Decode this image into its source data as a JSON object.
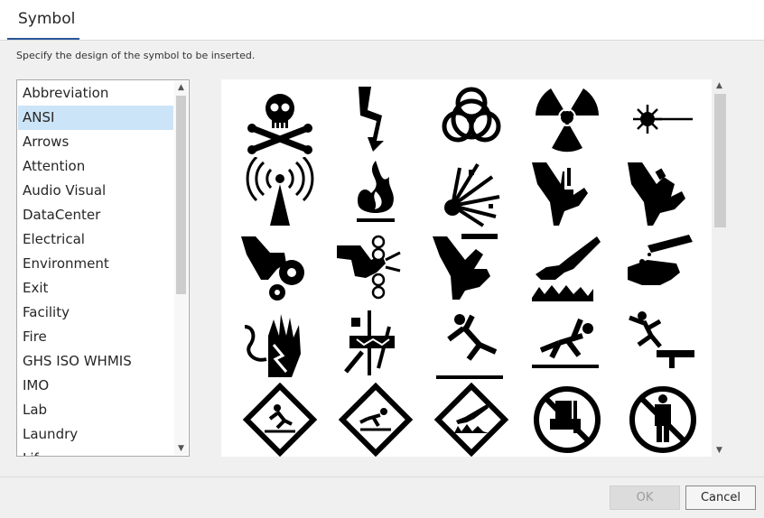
{
  "tab": {
    "label": "Symbol"
  },
  "description": "Specify the design of the symbol to be inserted.",
  "categories": [
    "Abbreviation",
    "ANSI",
    "Arrows",
    "Attention",
    "Audio Visual",
    "DataCenter",
    "Electrical",
    "Environment",
    "Exit",
    "Facility",
    "Fire",
    "GHS ISO WHMIS",
    "IMO",
    "Lab",
    "Laundry",
    "Lif"
  ],
  "selected_category": "ANSI",
  "symbols": [
    "skull-and-crossbones-icon",
    "high-voltage-icon",
    "biohazard-icon",
    "radiation-icon",
    "laser-icon",
    "radio-frequency-icon",
    "flammable-icon",
    "explosive-icon",
    "hand-crush-top-icon",
    "hand-crush-side-icon",
    "hand-gear-entanglement-icon",
    "hand-roller-entanglement-icon",
    "hand-cut-icon",
    "corrosive-hand-icon",
    "corrosive-skin-icon",
    "hand-electric-shock-icon",
    "electrical-arc-icon",
    "slippery-floor-icon",
    "trip-hazard-icon",
    "fall-hazard-icon",
    "slip-warning-diamond-icon",
    "trip-warning-diamond-icon",
    "hand-hazard-diamond-icon",
    "no-forklift-icon",
    "no-pedestrian-icon"
  ],
  "buttons": {
    "ok": "OK",
    "cancel": "Cancel"
  },
  "colors": {
    "selection": "#cce4f7",
    "accent": "#2b579a"
  }
}
